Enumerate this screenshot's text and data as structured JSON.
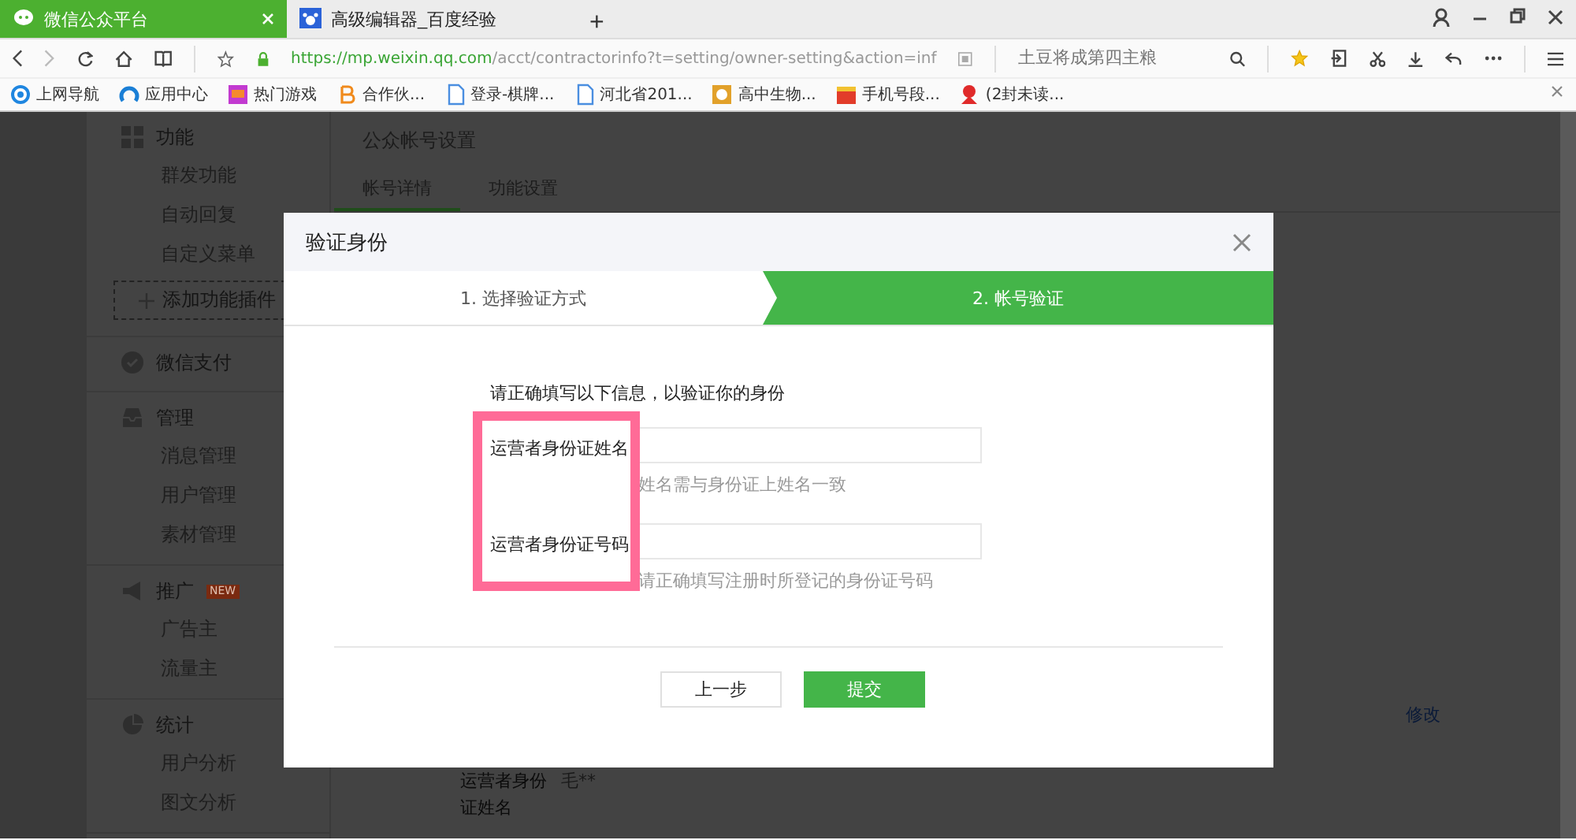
{
  "browser": {
    "tabs": [
      {
        "label": "微信公众平台",
        "selected": true
      },
      {
        "label": "高级编辑器_百度经验",
        "selected": false
      }
    ],
    "new_tab": "+",
    "address": {
      "host": "https://mp.weixin.qq.com",
      "path": "/acct/contractorinfo?t=setting/owner-setting&action=inf"
    },
    "search": {
      "placeholder": "土豆将成第四主粮"
    },
    "bookmarks": [
      {
        "label": "上网导航"
      },
      {
        "label": "应用中心"
      },
      {
        "label": "热门游戏"
      },
      {
        "label": "合作伙..."
      },
      {
        "label": "登录-棋牌..."
      },
      {
        "label": "河北省201..."
      },
      {
        "label": "高中生物..."
      },
      {
        "label": "手机号段..."
      },
      {
        "label": "(2封未读..."
      }
    ]
  },
  "sidebar": {
    "groups": [
      {
        "title": "功能",
        "items": [
          {
            "label": "群发功能"
          },
          {
            "label": "自动回复"
          },
          {
            "label": "自定义菜单"
          }
        ],
        "add_button": "添加功能插件"
      },
      {
        "title": "微信支付"
      },
      {
        "title": "管理",
        "items": [
          {
            "label": "消息管理"
          },
          {
            "label": "用户管理"
          },
          {
            "label": "素材管理"
          }
        ]
      },
      {
        "title": "推广",
        "badge": "NEW",
        "items": [
          {
            "label": "广告主"
          },
          {
            "label": "流量主"
          }
        ]
      },
      {
        "title": "统计",
        "items": [
          {
            "label": "用户分析"
          },
          {
            "label": "图文分析"
          }
        ]
      }
    ]
  },
  "main": {
    "title": "公众帐号设置",
    "tabs": [
      {
        "label": "帐号详情",
        "selected": true
      },
      {
        "label": "功能设置",
        "selected": false
      }
    ],
    "edit_link": "修改",
    "detail": {
      "label": "运营者身份证姓名",
      "value": "毛**"
    }
  },
  "dialog": {
    "title": "验证身份",
    "steps": [
      {
        "label": "1. 选择验证方式",
        "selected": false
      },
      {
        "label": "2. 帐号验证",
        "selected": true
      }
    ],
    "intro": "请正确填写以下信息，以验证你的身份",
    "fields": [
      {
        "label": "运营者身份证姓名",
        "hint": "姓名需与身份证上姓名一致"
      },
      {
        "label": "运营者身份证号码",
        "hint": "请正确填写注册时所登记的身份证号码"
      }
    ],
    "buttons": [
      {
        "label": "上一步",
        "kind": "secondary"
      },
      {
        "label": "提交",
        "kind": "primary"
      }
    ]
  }
}
